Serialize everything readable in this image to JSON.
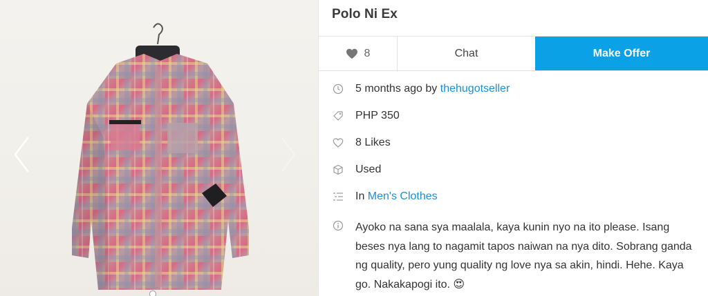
{
  "listing": {
    "title": "Polo Ni Ex"
  },
  "actions": {
    "likes_count": "8",
    "chat_label": "Chat",
    "offer_label": "Make Offer",
    "accent_color": "#0ba1e6"
  },
  "details": {
    "posted": "5 months ago by ",
    "seller": "thehugotseller",
    "price": "PHP 350",
    "likes": "8 Likes",
    "condition": "Used",
    "category_prefix": "In ",
    "category": "Men's Clothes",
    "description": "Ayoko na sana sya maalala, kaya kunin nyo na ito please. Isang beses nya lang to nagamit tapos naiwan na nya dito. Sobrang ganda ng quality, pero yung quality ng love nya sa akin, hindi. Hehe. Kaya go. Nakakapogi ito. 😍"
  },
  "icons": {
    "like": "heart-icon",
    "posted": "clock-icon",
    "price": "price-tag-icon",
    "likes": "heart-outline-icon",
    "condition": "box-icon",
    "category": "category-list-icon",
    "description": "info-icon",
    "prev": "chevron-left-icon",
    "next": "chevron-right-icon"
  }
}
